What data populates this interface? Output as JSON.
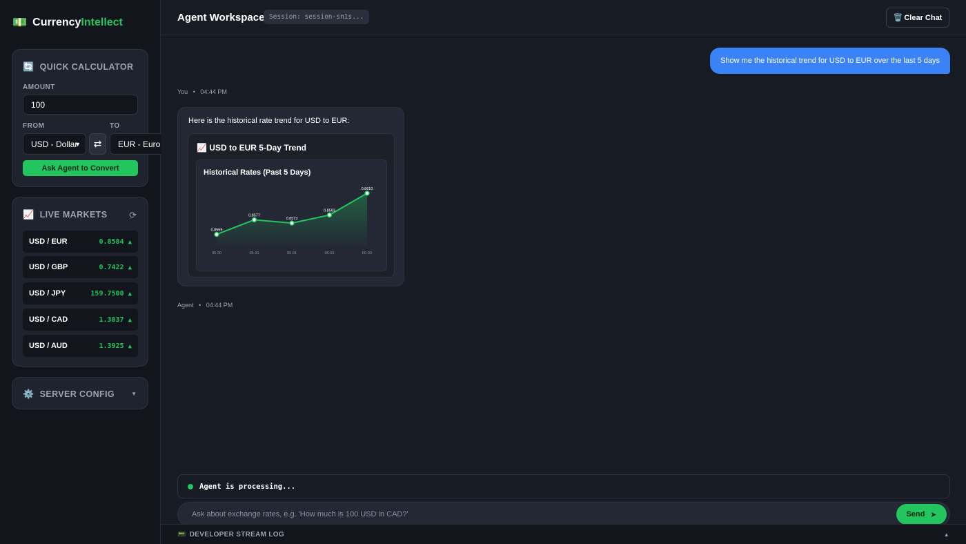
{
  "brand": {
    "logo_icon": "💵",
    "name_part1": "Currency",
    "name_part2": "Intellect"
  },
  "calculator": {
    "icon": "🔄",
    "title": "QUICK CALCULATOR",
    "amount_label": "AMOUNT",
    "amount_value": "100",
    "from_label": "FROM",
    "to_label": "TO",
    "from_value": "USD - Dollar",
    "to_value": "EUR - Euro",
    "swap_icon": "⇄",
    "convert_label": "Ask Agent to Convert"
  },
  "markets": {
    "icon": "📈",
    "title": "LIVE MARKETS",
    "refresh_icon": "⟳",
    "rows": [
      {
        "pair": "USD / EUR",
        "value": "0.8584",
        "trend": "▲"
      },
      {
        "pair": "USD / GBP",
        "value": "0.7422",
        "trend": "▲"
      },
      {
        "pair": "USD / JPY",
        "value": "159.7500",
        "trend": "▲"
      },
      {
        "pair": "USD / CAD",
        "value": "1.3837",
        "trend": "▲"
      },
      {
        "pair": "USD / AUD",
        "value": "1.3925",
        "trend": "▲"
      }
    ]
  },
  "server": {
    "icon": "⚙️",
    "title": "SERVER CONFIG",
    "chevron": "▼"
  },
  "header": {
    "title": "Agent Workspace",
    "session": "Session: session-sn1s...",
    "clear_icon": "🗑️",
    "clear_label": "Clear Chat"
  },
  "messages": {
    "user_text": "Show me the historical trend for USD to EUR over the last 5 days",
    "user_sender": "You",
    "user_time": "04:44 PM",
    "agent_intro": "Here is the historical rate trend for USD to EUR:",
    "agent_card_icon": "📈",
    "agent_card_title": "USD to EUR 5-Day Trend",
    "agent_sender": "Agent",
    "agent_time": "04:44 PM",
    "separator": "•"
  },
  "chart_data": {
    "type": "area",
    "title": "Historical Rates (Past 5 Days)",
    "categories": [
      "05-30",
      "05-31",
      "06-01",
      "06-02",
      "06-03"
    ],
    "values": [
      0.8559,
      0.8577,
      0.8573,
      0.8583,
      0.861
    ],
    "labels": [
      "0.8559",
      "0.8577",
      "0.8573",
      "0.8583",
      "0.8610"
    ],
    "ylim": [
      0.855,
      0.8615
    ],
    "grid": false,
    "line_color": "#22c55e"
  },
  "status": {
    "text": "Agent is processing..."
  },
  "composer": {
    "placeholder": "Ask about exchange rates, e.g. 'How much is 100 USD in CAD?'",
    "send_label": "Send",
    "send_icon": "➤"
  },
  "devlog": {
    "icon": "📟",
    "label": "DEVELOPER STREAM LOG",
    "caret": "▲"
  },
  "colors": {
    "accent": "#22c55e",
    "user_bubble": "#3b82f6",
    "background": "#171b24"
  }
}
